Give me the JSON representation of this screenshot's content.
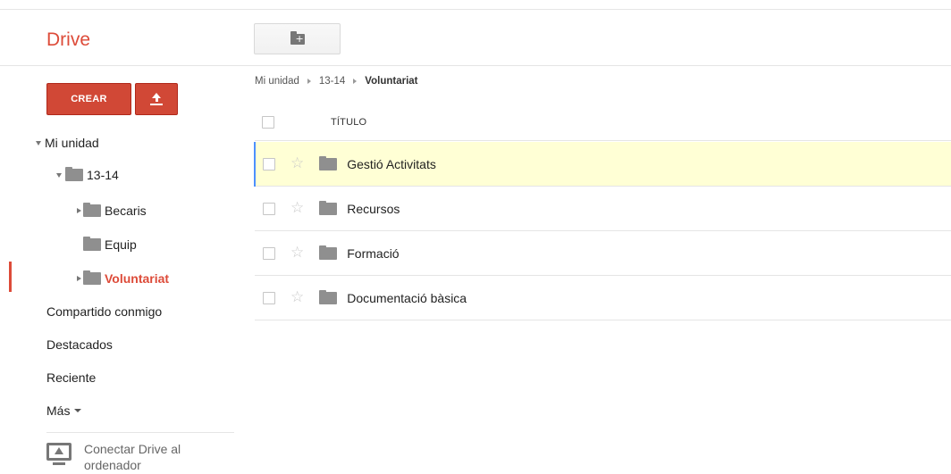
{
  "app": {
    "brand": "Drive"
  },
  "toolbar": {
    "new_folder_icon": "folder-plus-icon"
  },
  "sidebar": {
    "create_label": "CREAR",
    "upload_icon": "upload-icon",
    "tree": {
      "root": "Mi unidad",
      "year": "13-14",
      "children": [
        "Becaris",
        "Equip",
        "Voluntariat"
      ],
      "active": "Voluntariat"
    },
    "links": {
      "shared": "Compartido conmigo",
      "starred": "Destacados",
      "recent": "Reciente",
      "more": "Más"
    },
    "connect": {
      "line1": "Conectar Drive al",
      "line2": "ordenador"
    }
  },
  "breadcrumb": [
    "Mi unidad",
    "13-14",
    "Voluntariat"
  ],
  "list": {
    "header_title": "TÍTULO",
    "rows": [
      {
        "name": "Gestió Activitats",
        "selected": true
      },
      {
        "name": "Recursos",
        "selected": false
      },
      {
        "name": "Formació",
        "selected": false
      },
      {
        "name": "Documentació bàsica",
        "selected": false
      }
    ]
  },
  "colors": {
    "brand": "#dd4b39",
    "create_button": "#d14836",
    "selected_row": "#ffffd5",
    "selection_accent": "#4d90fe"
  }
}
